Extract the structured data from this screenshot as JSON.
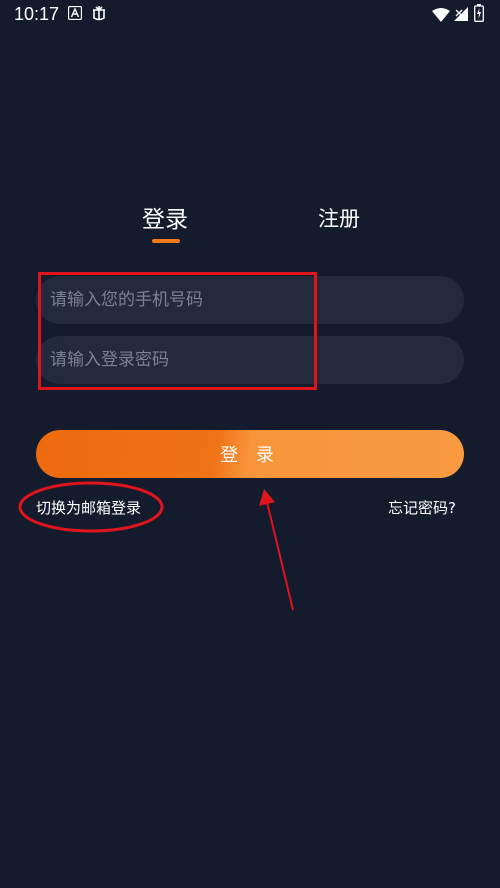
{
  "status_bar": {
    "time": "10:17",
    "left_icons": [
      "a-box-icon",
      "bug-icon"
    ],
    "right_icons": [
      "wifi-icon",
      "signal-icon",
      "battery-icon"
    ]
  },
  "tabs": {
    "login_label": "登录",
    "register_label": "注册",
    "active": "login"
  },
  "form": {
    "phone_placeholder": "请输入您的手机号码",
    "password_placeholder": "请输入登录密码",
    "phone_value": "",
    "password_value": ""
  },
  "login_button_label": "登 录",
  "switch_email_label": "切换为邮箱登录",
  "forgot_password_label": "忘记密码?",
  "colors": {
    "background": "#141b2d",
    "input_bg": "#222a3b",
    "accent_orange": "#f27a1a",
    "annotation_red": "#e0141c"
  }
}
